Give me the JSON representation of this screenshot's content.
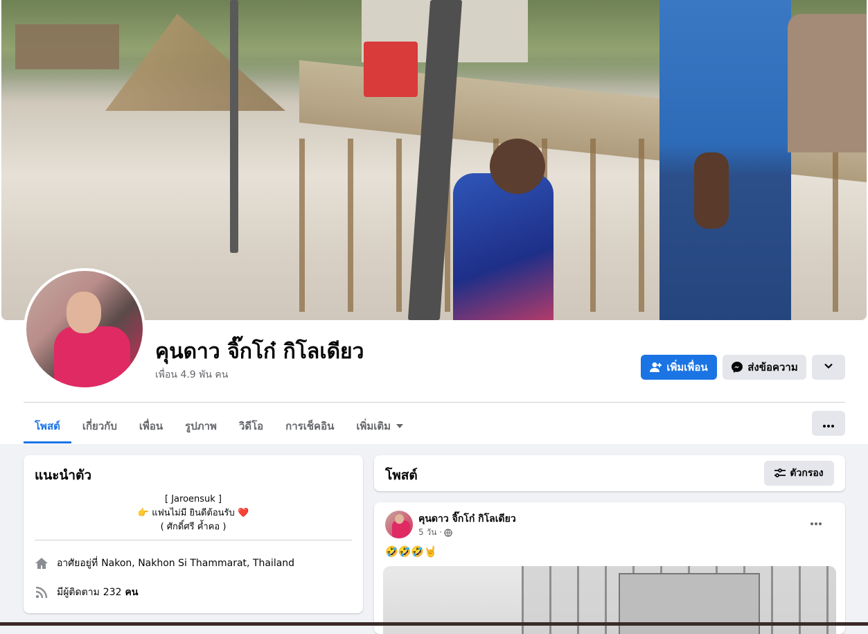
{
  "profile": {
    "name": "คุนดาว จิ๊กโก๋ กิโลเดียว",
    "friends": "เพื่อน 4.9 พัน คน"
  },
  "actions": {
    "add_friend": "เพิ่มเพื่อน",
    "message": "ส่งข้อความ"
  },
  "tabs": [
    {
      "label": "โพสต์",
      "active": true
    },
    {
      "label": "เกี่ยวกับ"
    },
    {
      "label": "เพื่อน"
    },
    {
      "label": "รูปภาพ"
    },
    {
      "label": "วิดีโอ"
    },
    {
      "label": "การเช็คอิน"
    },
    {
      "label": "เพิ่มเติม"
    }
  ],
  "intro": {
    "title": "แนะนำตัว",
    "bio_line1": "[ Jaroensuk ]",
    "bio_line2_prefix": "👉",
    "bio_line2": "แฟนไม่มี ยินดีต้อนรับ",
    "bio_line2_suffix": "❤️",
    "bio_line3": "( ศักดิ์ศรี ค้ำคอ )",
    "lives_prefix": "อาศัยอยู่ที่",
    "lives": "Nakon, Nakhon Si Thammarat, Thailand",
    "followers_prefix": "มีผู้ติดตาม",
    "followers_count": "232",
    "followers_suffix": "คน"
  },
  "posts": {
    "title": "โพสต์",
    "filter": "ตัวกรอง"
  },
  "post": {
    "author": "คุนดาว จิ๊กโก๋ กิโลเดียว",
    "time": "5 วัน ·",
    "text": "🤣🤣🤣🤘"
  },
  "colors": {
    "accent": "#1b74e4",
    "background": "#f0f2f5",
    "secondary_button": "#e4e6eb"
  }
}
